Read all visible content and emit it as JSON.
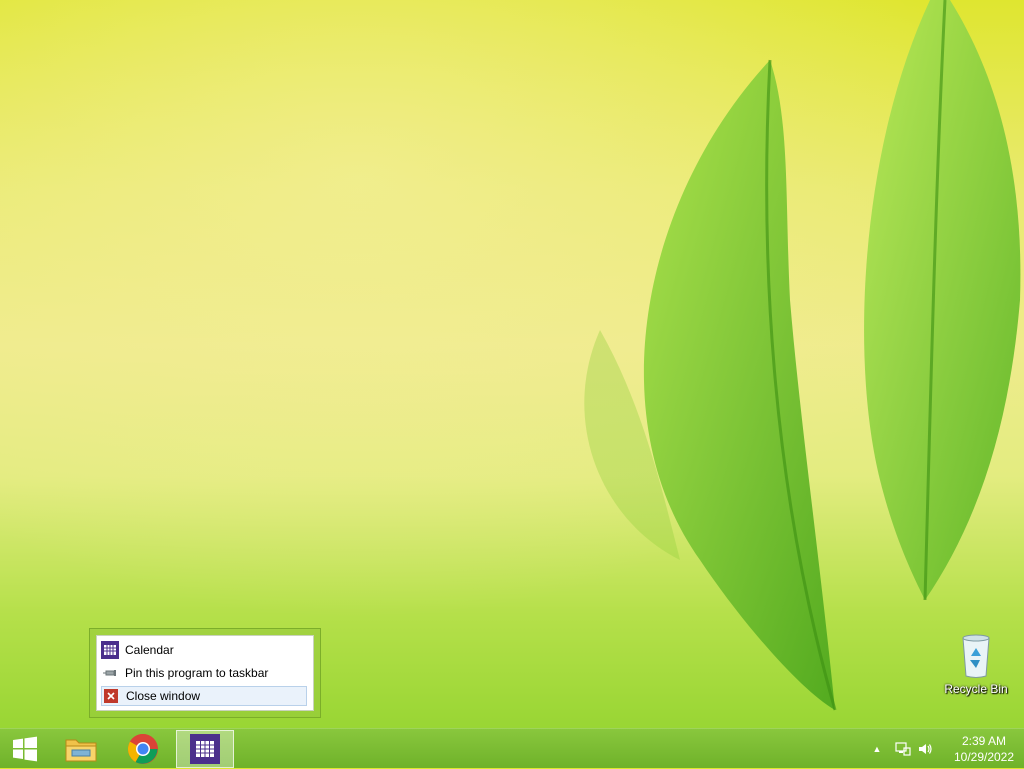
{
  "desktop": {
    "icons": [
      {
        "label": "Recycle Bin",
        "icon": "recycle-bin-icon"
      }
    ]
  },
  "jumplist": {
    "app_title": "Calendar",
    "pin_label": "Pin this program to taskbar",
    "close_label": "Close window"
  },
  "taskbar": {
    "items": [
      {
        "name": "start",
        "icon": "windows-logo-icon"
      },
      {
        "name": "file-explorer",
        "icon": "folder-icon"
      },
      {
        "name": "chrome",
        "icon": "chrome-icon"
      },
      {
        "name": "calendar",
        "icon": "calendar-icon",
        "active": true
      }
    ],
    "tray": {
      "icons": [
        "chevron-up-icon",
        "network-icon",
        "volume-icon"
      ],
      "time": "2:39 AM",
      "date": "10/29/2022"
    }
  },
  "colors": {
    "taskbar": "#7aba33",
    "accent_purple": "#4b2f8c",
    "close_red": "#c0392b"
  }
}
